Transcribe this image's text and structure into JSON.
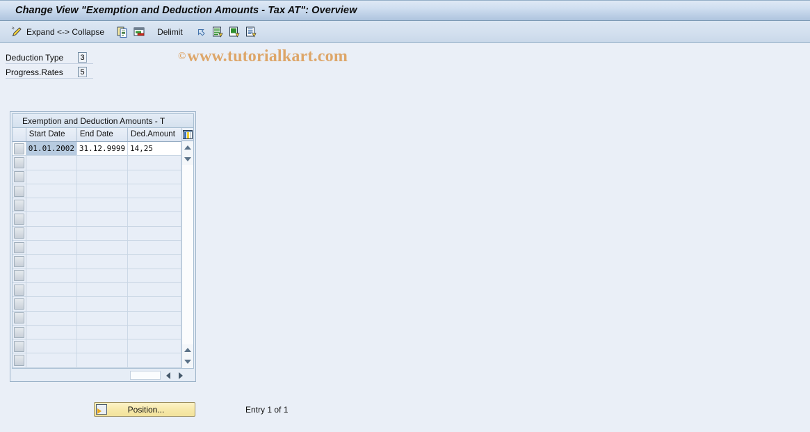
{
  "window": {
    "title": "Change View \"Exemption and Deduction Amounts - Tax AT\": Overview"
  },
  "toolbar": {
    "expand_collapse_label": "Expand <-> Collapse",
    "delimit_label": "Delimit",
    "icons": [
      "pencil-edit-icon",
      "copy-icon",
      "paste-overwrite-icon",
      "undo-arrow-icon",
      "new-entries-icon",
      "copy-as-icon",
      "details-icon"
    ]
  },
  "watermark": {
    "copyright": "©",
    "text": "www.tutorialkart.com",
    "color": "#d98a33"
  },
  "fields": [
    {
      "label": "Deduction Type",
      "value": "3"
    },
    {
      "label": "Progress.Rates",
      "value": "5"
    }
  ],
  "table": {
    "caption": "Exemption and Deduction Amounts - T",
    "columns": [
      "Start Date",
      "End Date",
      "Ded.Amount"
    ],
    "column_config_icon": "column-settings-icon",
    "rows": [
      {
        "start_date": "01.01.2002",
        "end_date": "31.12.9999",
        "amount": "14,25",
        "selected": true
      },
      {
        "start_date": "",
        "end_date": "",
        "amount": "",
        "selected": false
      },
      {
        "start_date": "",
        "end_date": "",
        "amount": "",
        "selected": false
      },
      {
        "start_date": "",
        "end_date": "",
        "amount": "",
        "selected": false
      },
      {
        "start_date": "",
        "end_date": "",
        "amount": "",
        "selected": false
      },
      {
        "start_date": "",
        "end_date": "",
        "amount": "",
        "selected": false
      },
      {
        "start_date": "",
        "end_date": "",
        "amount": "",
        "selected": false
      },
      {
        "start_date": "",
        "end_date": "",
        "amount": "",
        "selected": false
      },
      {
        "start_date": "",
        "end_date": "",
        "amount": "",
        "selected": false
      },
      {
        "start_date": "",
        "end_date": "",
        "amount": "",
        "selected": false
      },
      {
        "start_date": "",
        "end_date": "",
        "amount": "",
        "selected": false
      },
      {
        "start_date": "",
        "end_date": "",
        "amount": "",
        "selected": false
      },
      {
        "start_date": "",
        "end_date": "",
        "amount": "",
        "selected": false
      },
      {
        "start_date": "",
        "end_date": "",
        "amount": "",
        "selected": false
      },
      {
        "start_date": "",
        "end_date": "",
        "amount": "",
        "selected": false
      },
      {
        "start_date": "",
        "end_date": "",
        "amount": "",
        "selected": false
      }
    ]
  },
  "footer": {
    "position_button_label": "Position...",
    "position_button_icon": "position-goto-icon",
    "entry_count": "Entry 1 of 1"
  }
}
